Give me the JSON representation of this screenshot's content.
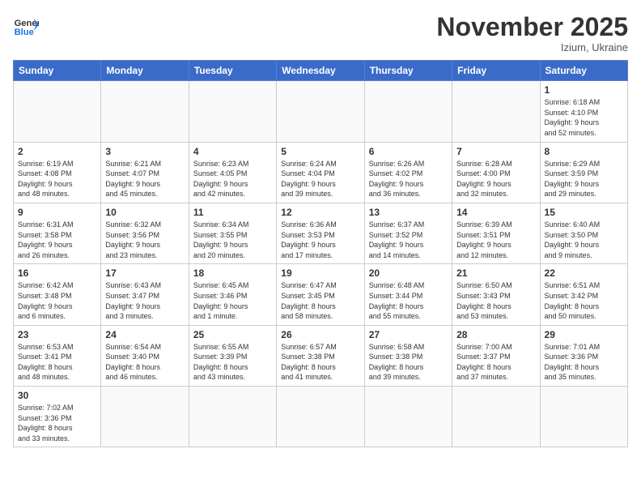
{
  "logo": {
    "general": "General",
    "blue": "Blue"
  },
  "title": "November 2025",
  "subtitle": "Izium, Ukraine",
  "days_header": [
    "Sunday",
    "Monday",
    "Tuesday",
    "Wednesday",
    "Thursday",
    "Friday",
    "Saturday"
  ],
  "weeks": [
    [
      {
        "num": "",
        "info": ""
      },
      {
        "num": "",
        "info": ""
      },
      {
        "num": "",
        "info": ""
      },
      {
        "num": "",
        "info": ""
      },
      {
        "num": "",
        "info": ""
      },
      {
        "num": "",
        "info": ""
      },
      {
        "num": "1",
        "info": "Sunrise: 6:18 AM\nSunset: 4:10 PM\nDaylight: 9 hours\nand 52 minutes."
      }
    ],
    [
      {
        "num": "2",
        "info": "Sunrise: 6:19 AM\nSunset: 4:08 PM\nDaylight: 9 hours\nand 48 minutes."
      },
      {
        "num": "3",
        "info": "Sunrise: 6:21 AM\nSunset: 4:07 PM\nDaylight: 9 hours\nand 45 minutes."
      },
      {
        "num": "4",
        "info": "Sunrise: 6:23 AM\nSunset: 4:05 PM\nDaylight: 9 hours\nand 42 minutes."
      },
      {
        "num": "5",
        "info": "Sunrise: 6:24 AM\nSunset: 4:04 PM\nDaylight: 9 hours\nand 39 minutes."
      },
      {
        "num": "6",
        "info": "Sunrise: 6:26 AM\nSunset: 4:02 PM\nDaylight: 9 hours\nand 36 minutes."
      },
      {
        "num": "7",
        "info": "Sunrise: 6:28 AM\nSunset: 4:00 PM\nDaylight: 9 hours\nand 32 minutes."
      },
      {
        "num": "8",
        "info": "Sunrise: 6:29 AM\nSunset: 3:59 PM\nDaylight: 9 hours\nand 29 minutes."
      }
    ],
    [
      {
        "num": "9",
        "info": "Sunrise: 6:31 AM\nSunset: 3:58 PM\nDaylight: 9 hours\nand 26 minutes."
      },
      {
        "num": "10",
        "info": "Sunrise: 6:32 AM\nSunset: 3:56 PM\nDaylight: 9 hours\nand 23 minutes."
      },
      {
        "num": "11",
        "info": "Sunrise: 6:34 AM\nSunset: 3:55 PM\nDaylight: 9 hours\nand 20 minutes."
      },
      {
        "num": "12",
        "info": "Sunrise: 6:36 AM\nSunset: 3:53 PM\nDaylight: 9 hours\nand 17 minutes."
      },
      {
        "num": "13",
        "info": "Sunrise: 6:37 AM\nSunset: 3:52 PM\nDaylight: 9 hours\nand 14 minutes."
      },
      {
        "num": "14",
        "info": "Sunrise: 6:39 AM\nSunset: 3:51 PM\nDaylight: 9 hours\nand 12 minutes."
      },
      {
        "num": "15",
        "info": "Sunrise: 6:40 AM\nSunset: 3:50 PM\nDaylight: 9 hours\nand 9 minutes."
      }
    ],
    [
      {
        "num": "16",
        "info": "Sunrise: 6:42 AM\nSunset: 3:48 PM\nDaylight: 9 hours\nand 6 minutes."
      },
      {
        "num": "17",
        "info": "Sunrise: 6:43 AM\nSunset: 3:47 PM\nDaylight: 9 hours\nand 3 minutes."
      },
      {
        "num": "18",
        "info": "Sunrise: 6:45 AM\nSunset: 3:46 PM\nDaylight: 9 hours\nand 1 minute."
      },
      {
        "num": "19",
        "info": "Sunrise: 6:47 AM\nSunset: 3:45 PM\nDaylight: 8 hours\nand 58 minutes."
      },
      {
        "num": "20",
        "info": "Sunrise: 6:48 AM\nSunset: 3:44 PM\nDaylight: 8 hours\nand 55 minutes."
      },
      {
        "num": "21",
        "info": "Sunrise: 6:50 AM\nSunset: 3:43 PM\nDaylight: 8 hours\nand 53 minutes."
      },
      {
        "num": "22",
        "info": "Sunrise: 6:51 AM\nSunset: 3:42 PM\nDaylight: 8 hours\nand 50 minutes."
      }
    ],
    [
      {
        "num": "23",
        "info": "Sunrise: 6:53 AM\nSunset: 3:41 PM\nDaylight: 8 hours\nand 48 minutes."
      },
      {
        "num": "24",
        "info": "Sunrise: 6:54 AM\nSunset: 3:40 PM\nDaylight: 8 hours\nand 46 minutes."
      },
      {
        "num": "25",
        "info": "Sunrise: 6:55 AM\nSunset: 3:39 PM\nDaylight: 8 hours\nand 43 minutes."
      },
      {
        "num": "26",
        "info": "Sunrise: 6:57 AM\nSunset: 3:38 PM\nDaylight: 8 hours\nand 41 minutes."
      },
      {
        "num": "27",
        "info": "Sunrise: 6:58 AM\nSunset: 3:38 PM\nDaylight: 8 hours\nand 39 minutes."
      },
      {
        "num": "28",
        "info": "Sunrise: 7:00 AM\nSunset: 3:37 PM\nDaylight: 8 hours\nand 37 minutes."
      },
      {
        "num": "29",
        "info": "Sunrise: 7:01 AM\nSunset: 3:36 PM\nDaylight: 8 hours\nand 35 minutes."
      }
    ],
    [
      {
        "num": "30",
        "info": "Sunrise: 7:02 AM\nSunset: 3:36 PM\nDaylight: 8 hours\nand 33 minutes."
      },
      {
        "num": "",
        "info": ""
      },
      {
        "num": "",
        "info": ""
      },
      {
        "num": "",
        "info": ""
      },
      {
        "num": "",
        "info": ""
      },
      {
        "num": "",
        "info": ""
      },
      {
        "num": "",
        "info": ""
      }
    ]
  ]
}
